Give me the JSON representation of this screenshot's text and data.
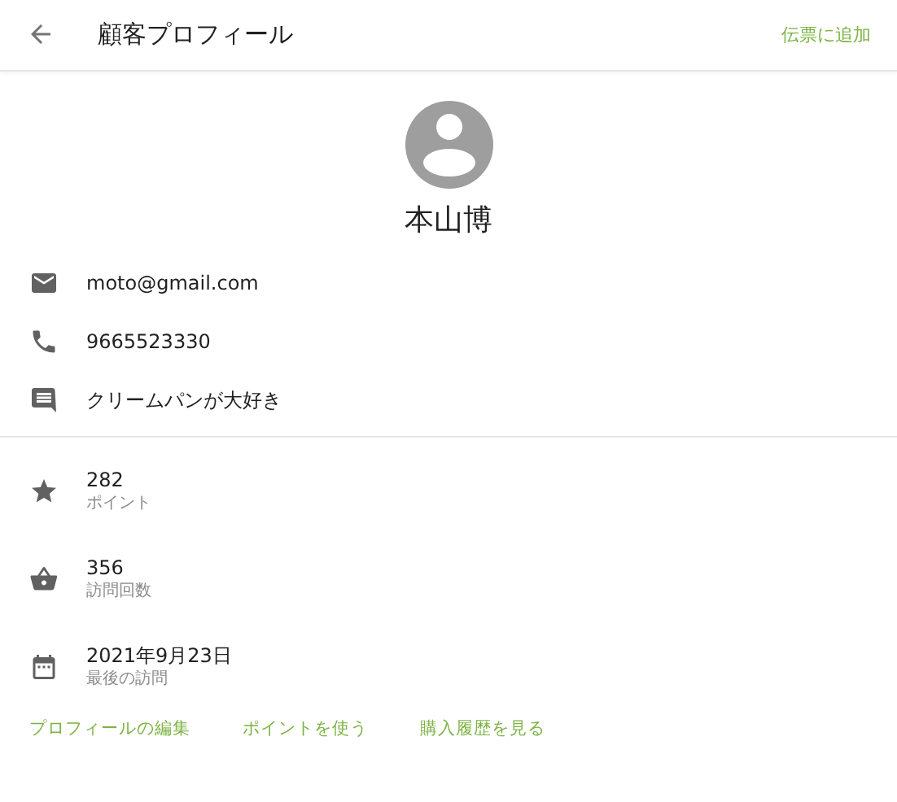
{
  "app_bar": {
    "title": "顧客プロフィール",
    "action": "伝票に追加"
  },
  "customer": {
    "name": "本山博"
  },
  "contacts": [
    {
      "kind": "email",
      "text": "moto@gmail.com"
    },
    {
      "kind": "phone",
      "text": "9665523330"
    },
    {
      "kind": "note",
      "text": "クリームパンが大好き"
    }
  ],
  "stats": [
    {
      "kind": "star",
      "value": "282",
      "label": "ポイント"
    },
    {
      "kind": "basket",
      "value": "356",
      "label": "訪問回数"
    },
    {
      "kind": "calendar",
      "value": "2021年9月23日",
      "label": "最後の訪問"
    }
  ],
  "actions": [
    "プロフィールの編集",
    "ポイントを使う",
    "購入履歴を見る"
  ]
}
